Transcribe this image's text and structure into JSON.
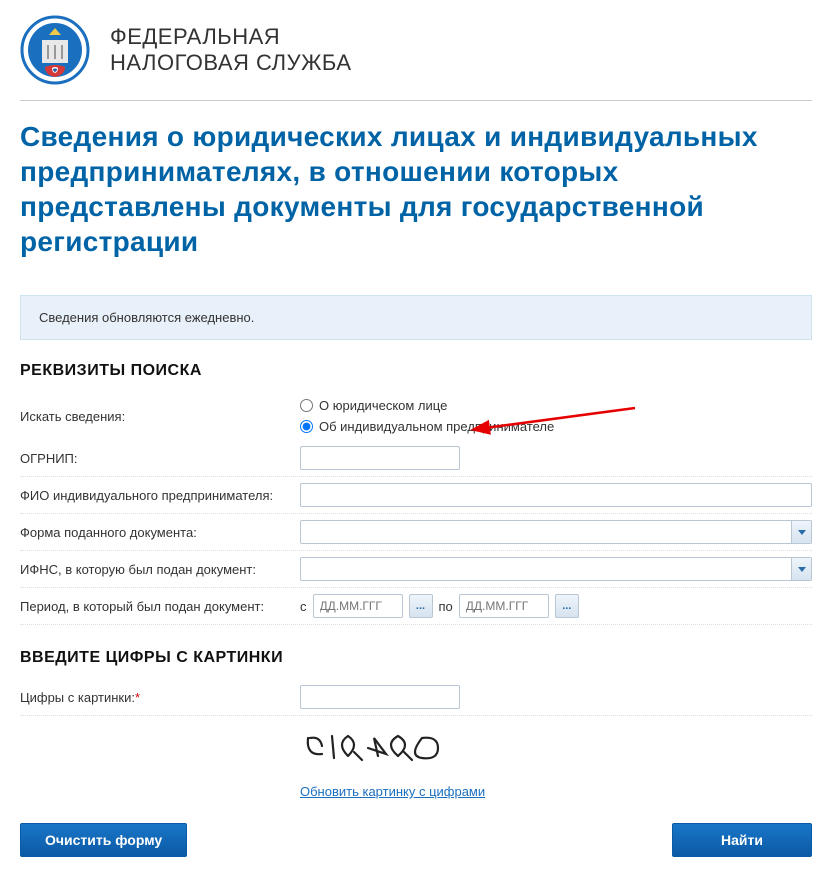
{
  "header": {
    "org_line1": "ФЕДЕРАЛЬНАЯ",
    "org_line2": "НАЛОГОВАЯ СЛУЖБА"
  },
  "page_title": "Сведения о юридических лицах и индивидуальных предпринимателях, в отношении которых представлены документы для государственной регистрации",
  "notice": "Сведения обновляются ежедневно.",
  "search": {
    "section_title": "РЕКВИЗИТЫ ПОИСКА",
    "labels": {
      "search_info": "Искать сведения:",
      "ogrnip": "ОГРНИП:",
      "fio": "ФИО индивидуального предпринимателя:",
      "doc_form": "Форма поданного документа:",
      "ifns": "ИФНС, в которую был подан документ:",
      "period": "Период, в который был подан документ:"
    },
    "radio": {
      "legal": "О юридическом лице",
      "individual": "Об индивидуальном предпринимателе"
    },
    "period": {
      "from": "с",
      "to": "по",
      "placeholder": "ДД.ММ.ГГГ",
      "picker_btn": "..."
    }
  },
  "captcha": {
    "section_title": "ВВЕДИТЕ ЦИФРЫ С КАРТИНКИ",
    "label": "Цифры с картинки:",
    "required": "*",
    "refresh_link": "Обновить картинку с цифрами",
    "image_value": "719490"
  },
  "buttons": {
    "clear": "Очистить форму",
    "find": "Найти"
  }
}
